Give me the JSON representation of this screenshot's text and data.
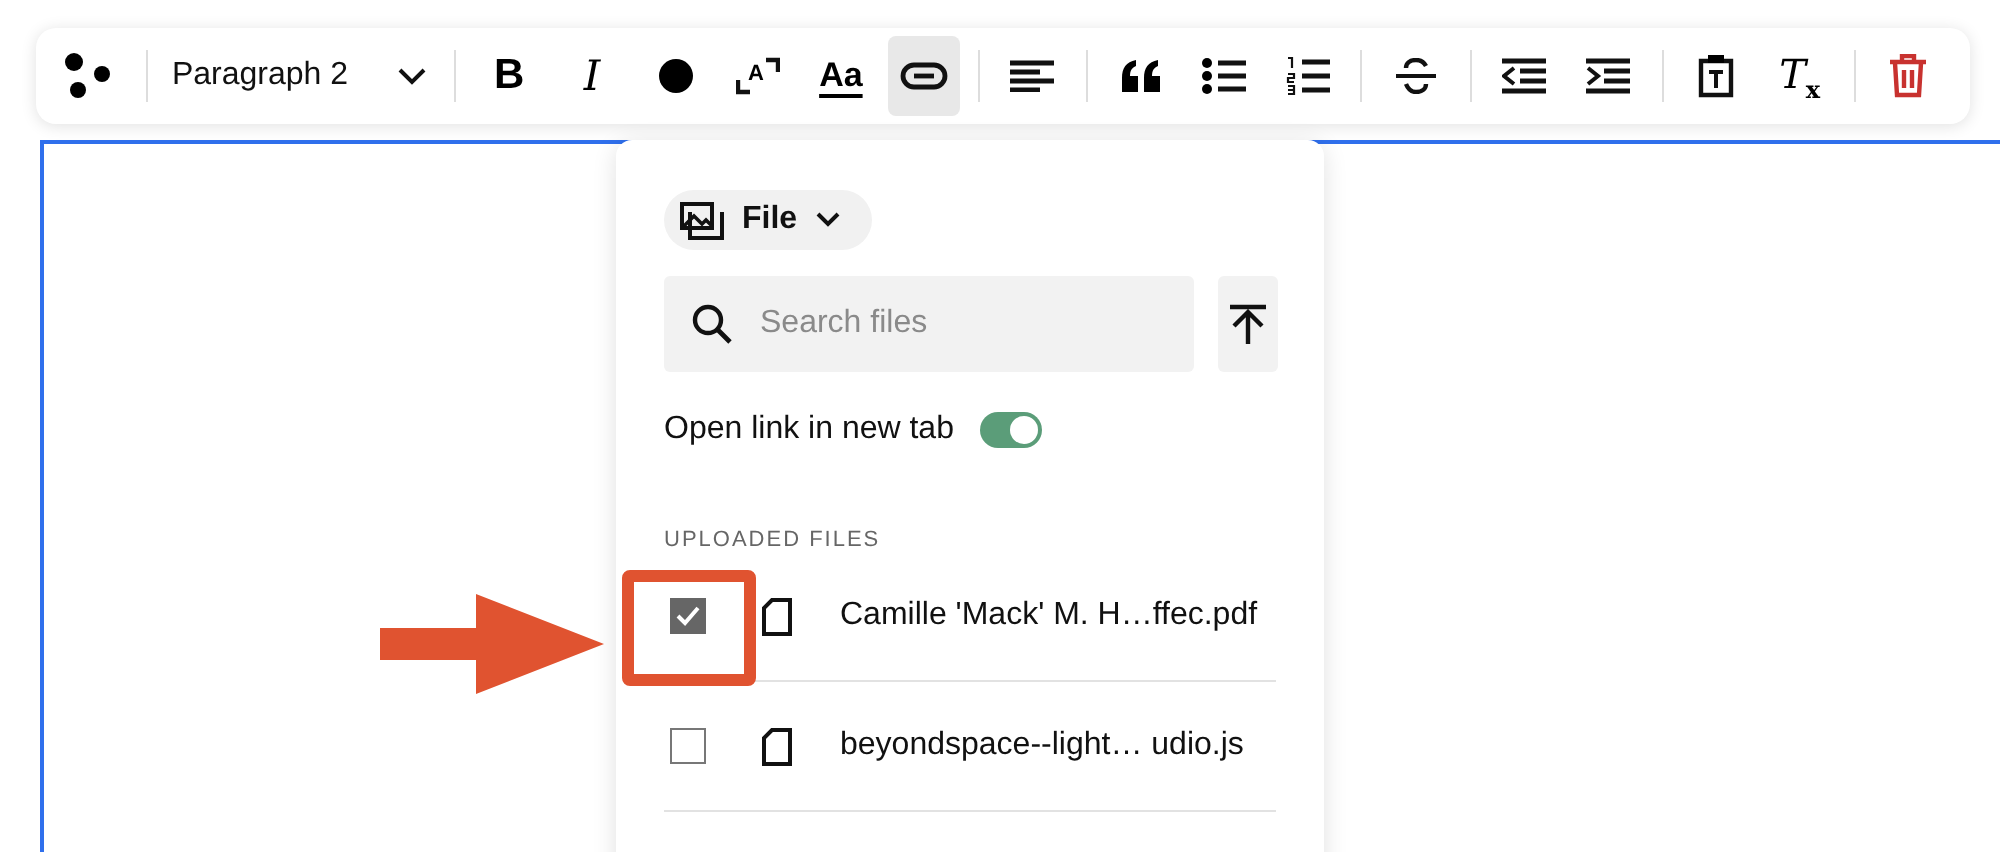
{
  "toolbar": {
    "groups": [
      [
        {
          "kind": "logo",
          "selected": false
        }
      ],
      [
        {
          "kind": "select",
          "value": "Paragraph 2",
          "selected": false
        }
      ],
      [
        {
          "kind": "bold",
          "glyph": "B",
          "selected": false
        },
        {
          "kind": "italic",
          "glyph": "I",
          "selected": false
        },
        {
          "kind": "color",
          "selected": false
        },
        {
          "kind": "size",
          "glyph": "A",
          "selected": false
        },
        {
          "kind": "font",
          "glyph": "Aa",
          "selected": false
        },
        {
          "kind": "link",
          "selected": true
        }
      ],
      [
        {
          "kind": "align",
          "selected": false
        }
      ],
      [
        {
          "kind": "quote",
          "selected": false
        },
        {
          "kind": "bullets",
          "selected": false
        },
        {
          "kind": "numbered",
          "selected": false
        }
      ],
      [
        {
          "kind": "strike",
          "selected": false
        }
      ],
      [
        {
          "kind": "outdent",
          "selected": false
        },
        {
          "kind": "indent",
          "selected": false
        }
      ],
      [
        {
          "kind": "clipboard",
          "selected": false
        },
        {
          "kind": "clear",
          "glyph": "T$_{x}$",
          "selected": false
        }
      ],
      [
        {
          "kind": "delete",
          "selected": false
        }
      ]
    ]
  },
  "link_panel": {
    "source": {
      "label": "File"
    },
    "search": {
      "placeholder": "Search files"
    },
    "new_tab": {
      "label": "Open link in new tab",
      "on": true
    },
    "section_title": "UPLOADED FILES",
    "files": [
      {
        "name": "Camille 'Mack' M. H…ffec.pdf",
        "checked": true
      },
      {
        "name": "beyondspace--light… udio.js",
        "checked": false
      }
    ]
  }
}
